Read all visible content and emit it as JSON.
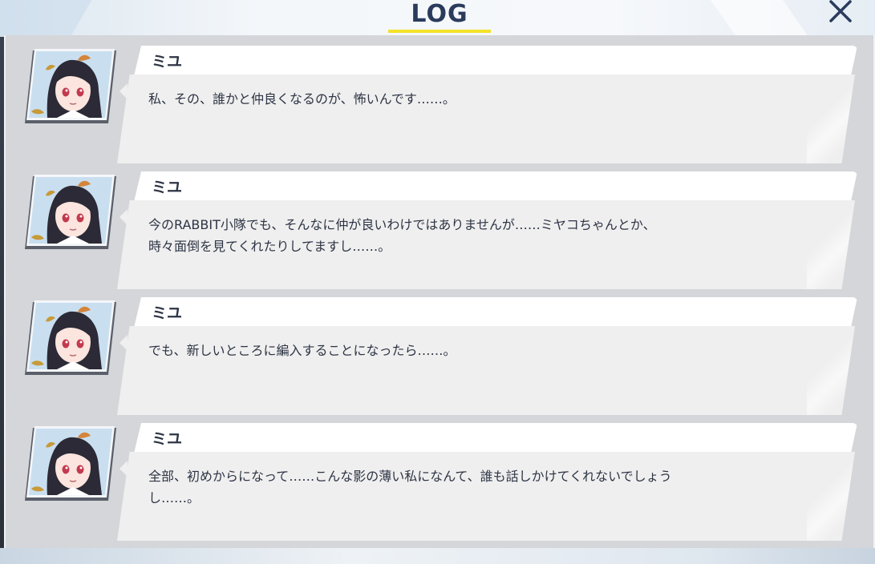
{
  "header": {
    "title": "LOG",
    "close_icon": "close-icon"
  },
  "colors": {
    "title": "#2a3b5c",
    "accent_underline": "#f3e12a",
    "panel_bg": "#d4d6d9",
    "bubble_bg": "#efefef",
    "name_bg": "#ffffff",
    "text": "#2d3444"
  },
  "log": {
    "entries": [
      {
        "speaker": "ミユ",
        "avatar_icon": "character-portrait-icon",
        "text": "私、その、誰かと仲良くなるのが、怖いんです……。"
      },
      {
        "speaker": "ミユ",
        "avatar_icon": "character-portrait-icon",
        "text": "今のRABBIT小隊でも、そんなに仲が良いわけではありませんが……ミヤコちゃんとか、\n時々面倒を見てくれたりしてますし……。"
      },
      {
        "speaker": "ミユ",
        "avatar_icon": "character-portrait-icon",
        "text": "でも、新しいところに編入することになったら……。"
      },
      {
        "speaker": "ミユ",
        "avatar_icon": "character-portrait-icon",
        "text": "全部、初めからになって……こんな影の薄い私になんて、誰も話しかけてくれないでしょう\nし……。"
      }
    ]
  }
}
